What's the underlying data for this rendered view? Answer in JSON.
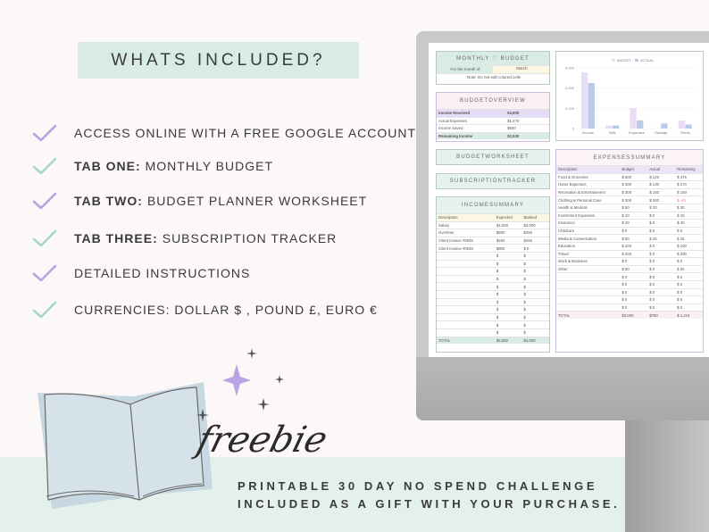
{
  "title": "WHATS INCLUDED?",
  "features": [
    {
      "bold": "",
      "text": "ACCESS ONLINE WITH A FREE GOOGLE ACCOUNT",
      "check": "#b8a2e0"
    },
    {
      "bold": "TAB ONE:",
      "text": "MONTHLY BUDGET",
      "check": "#a6d7c6"
    },
    {
      "bold": "TAB TWO:",
      "text": "BUDGET PLANNER WORKSHEET",
      "check": "#b8a2e0"
    },
    {
      "bold": "TAB THREE:",
      "text": "SUBSCRIPTION TRACKER",
      "check": "#a6d7c6"
    },
    {
      "bold": "",
      "text": "DETAILED INSTRUCTIONS",
      "check": "#b8a2e0"
    },
    {
      "bold": "",
      "text": "CURRENCIES: DOLLAR $ , POUND £, EURO €",
      "check": "#a6d7c6"
    }
  ],
  "freebie": "freebie",
  "gift_line1": "PRINTABLE 30 DAY NO SPEND CHALLENGE",
  "gift_line2": "INCLUDED AS A GIFT WITH YOUR PURCHASE.",
  "sheet": {
    "monthly_title": "MONTHLY ♡ BUDGET",
    "month_label": "For the month of:",
    "month_value": "March",
    "note": "Note: Do not edit colored cells",
    "overview_title": "BUDGETOVERVIEW",
    "overview": [
      [
        "Income Received",
        "$4,600"
      ],
      [
        "Actual Expenses",
        "$1,470"
      ],
      [
        "Income Saved",
        "$500"
      ],
      [
        "Remaining Income",
        "$2,530"
      ]
    ],
    "worksheet_btn": "BUDGETWORKSHEET",
    "subscription_btn": "SUBSCRIPTIONTRACKER",
    "income_title": "INCOMESUMMARY",
    "income_headers": [
      "Description",
      "Expected",
      "Banked"
    ],
    "income_rows": [
      [
        "Salary",
        "$4,000",
        "$4,000"
      ],
      [
        "Overtime",
        "$500",
        "$250"
      ],
      [
        "Client Invoice #0045",
        "$250",
        "$250"
      ],
      [
        "Client Invoice #0046",
        "$800",
        "$ 0"
      ],
      [
        "",
        "$",
        "$"
      ],
      [
        "",
        "$",
        "$"
      ],
      [
        "",
        "$",
        "$"
      ],
      [
        "",
        "$",
        "$"
      ],
      [
        "",
        "$",
        "$"
      ],
      [
        "",
        "$",
        "$"
      ],
      [
        "",
        "$",
        "$"
      ],
      [
        "",
        "$",
        "$"
      ],
      [
        "",
        "$",
        "$"
      ],
      [
        "",
        "$",
        "$"
      ],
      [
        "",
        "$",
        "$"
      ]
    ],
    "income_total": [
      "TOTAL",
      "$5,550",
      "$4,500"
    ],
    "expense_title": "EXPENSESSUMMARY",
    "expense_headers": [
      "Description",
      "Budget",
      "Actual",
      "Remaining"
    ],
    "expense_rows": [
      [
        "Food & Groceries",
        "$ 600",
        "$ 125",
        "$ 475"
      ],
      [
        "Home Expenses",
        "$ 300",
        "$ 130",
        "$ 170"
      ],
      [
        "Recreation & Entertainment",
        "$ 300",
        "$ 150",
        "$ 150"
      ],
      [
        "Clothing & Personal Care",
        "$ 300",
        "$ 340",
        "$ -40"
      ],
      [
        "Health & Medical",
        "$ 50",
        "$ 20",
        "$ 30"
      ],
      [
        "Investment Expenses",
        "$ 10",
        "$ 0",
        "$ 10"
      ],
      [
        "Insurance",
        "$ 40",
        "$ 0",
        "$ 40"
      ],
      [
        "Childcare",
        "$ 0",
        "$ 0",
        "$ 0"
      ],
      [
        "Media & Comunication",
        "$ 50",
        "$ 25",
        "$ 25"
      ],
      [
        "Education",
        "$ 100",
        "$ 0",
        "$ 100"
      ],
      [
        "Travel",
        "$ 200",
        "$ 0",
        "$ 200"
      ],
      [
        "Work & Business",
        "$ 0",
        "$ 0",
        "$ 0"
      ],
      [
        "Other",
        "$ 50",
        "$ 0",
        "$ 50"
      ],
      [
        "",
        "$ 0",
        "$ 0",
        "$ 0"
      ],
      [
        "",
        "$ 0",
        "$ 0",
        "$ 0"
      ],
      [
        "",
        "$ 0",
        "$ 0",
        "$ 0"
      ],
      [
        "",
        "$ 0",
        "$ 0",
        "$ 0"
      ],
      [
        "",
        "$ 0",
        "$ 0",
        "$ 0"
      ]
    ],
    "expense_total": [
      "TOTAL",
      "$3,000",
      "$790",
      "$ 1,210"
    ]
  },
  "chart_data": {
    "type": "bar",
    "categories": [
      "Income",
      "Bills",
      "Expenses",
      "Savings",
      "Rents"
    ],
    "series": [
      {
        "name": "BUDGET",
        "values": [
          5550,
          300,
          2000,
          0,
          800
        ],
        "color": "#e9def5"
      },
      {
        "name": "ACTUAL",
        "values": [
          4500,
          300,
          800,
          500,
          400
        ],
        "color": "#b9cbe8"
      }
    ],
    "yticks": [
      "0",
      "2,000",
      "4,000",
      "6,000"
    ],
    "ylim": [
      0,
      6000
    ],
    "legend": "top"
  },
  "colors": {
    "mint": "#d8ece5",
    "lavender": "#e6dcf5",
    "cream": "#fbf7e2",
    "pink": "#fbeef4"
  }
}
